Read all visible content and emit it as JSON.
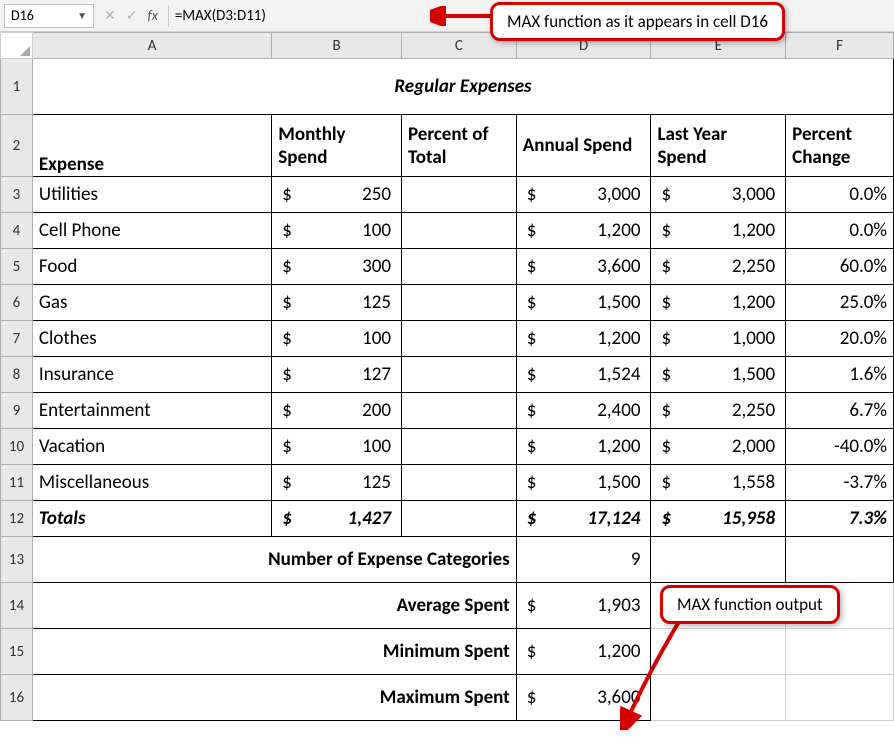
{
  "formula_bar": {
    "cell_ref": "D16",
    "x_icon": "✕",
    "check_icon": "✓",
    "fx_label": "fx",
    "formula": "=MAX(D3:D11)"
  },
  "callouts": {
    "top": "MAX function as it appears in cell D16",
    "bottom": "MAX function output"
  },
  "columns": [
    "A",
    "B",
    "C",
    "D",
    "E",
    "F"
  ],
  "title": "Regular Expenses",
  "headers": {
    "A": "Expense",
    "B": "Monthly Spend",
    "C": "Percent of Total",
    "D": "Annual Spend",
    "E": "Last Year Spend",
    "F": "Percent Change"
  },
  "rows": [
    {
      "r": "3",
      "expense": "Utilities",
      "monthly": "250",
      "annual": "3,000",
      "last": "3,000",
      "pct": "0.0%"
    },
    {
      "r": "4",
      "expense": "Cell Phone",
      "monthly": "100",
      "annual": "1,200",
      "last": "1,200",
      "pct": "0.0%"
    },
    {
      "r": "5",
      "expense": "Food",
      "monthly": "300",
      "annual": "3,600",
      "last": "2,250",
      "pct": "60.0%"
    },
    {
      "r": "6",
      "expense": "Gas",
      "monthly": "125",
      "annual": "1,500",
      "last": "1,200",
      "pct": "25.0%"
    },
    {
      "r": "7",
      "expense": "Clothes",
      "monthly": "100",
      "annual": "1,200",
      "last": "1,000",
      "pct": "20.0%"
    },
    {
      "r": "8",
      "expense": "Insurance",
      "monthly": "127",
      "annual": "1,524",
      "last": "1,500",
      "pct": "1.6%"
    },
    {
      "r": "9",
      "expense": "Entertainment",
      "monthly": "200",
      "annual": "2,400",
      "last": "2,250",
      "pct": "6.7%"
    },
    {
      "r": "10",
      "expense": "Vacation",
      "monthly": "100",
      "annual": "1,200",
      "last": "2,000",
      "pct": "-40.0%"
    },
    {
      "r": "11",
      "expense": "Miscellaneous",
      "monthly": "125",
      "annual": "1,500",
      "last": "1,558",
      "pct": "-3.7%"
    }
  ],
  "totals": {
    "r": "12",
    "label": "Totals",
    "monthly": "1,427",
    "annual": "17,124",
    "last": "15,958",
    "pct": "7.3%"
  },
  "summary": {
    "num_cat": {
      "r": "13",
      "label": "Number of Expense Categories",
      "value": "9"
    },
    "avg": {
      "r": "14",
      "label": "Average Spent",
      "value": "1,903"
    },
    "min": {
      "r": "15",
      "label": "Minimum Spent",
      "value": "1,200"
    },
    "max": {
      "r": "16",
      "label": "Maximum Spent",
      "value": "3,600"
    }
  },
  "currency": "$"
}
